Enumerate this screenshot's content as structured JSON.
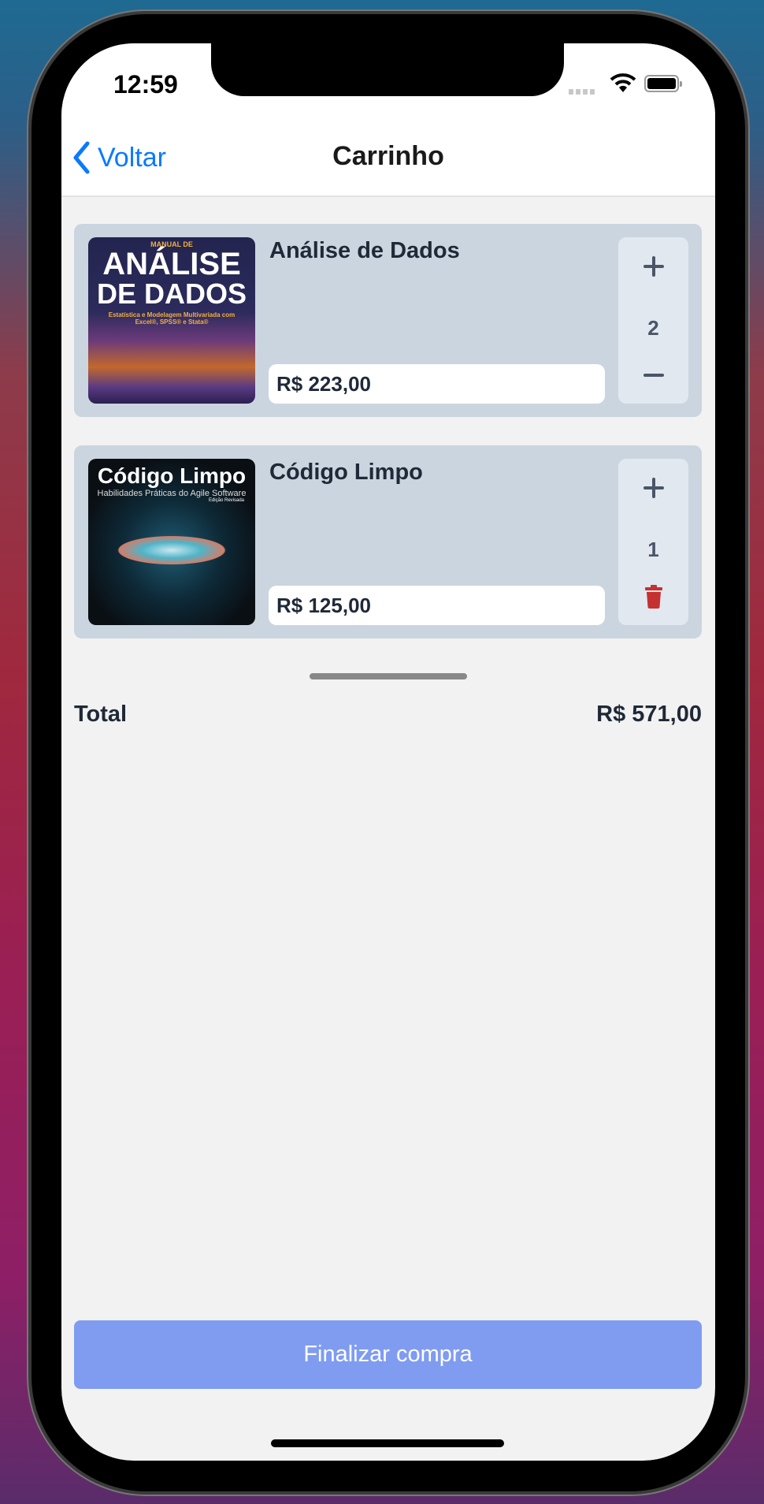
{
  "status_bar": {
    "time": "12:59",
    "icons": [
      "signal-icon",
      "wifi-icon",
      "battery-icon"
    ]
  },
  "nav": {
    "back_label": "Voltar",
    "title": "Carrinho"
  },
  "cart": {
    "items": [
      {
        "title": "Análise de Dados",
        "price": "R$ 223,00",
        "quantity": "2",
        "cover_text": [
          "MANUAL DE",
          "ANÁLISE",
          "DE DADOS",
          "Estatística e Modelagem Multivariada com",
          "Excel®, SPSS® e Stata®"
        ],
        "decrement_icon": "minus-icon"
      },
      {
        "title": "Código Limpo",
        "price": "R$ 125,00",
        "quantity": "1",
        "cover_text": [
          "Código Limpo",
          "Habilidades Práticas do Agile Software",
          "Edição Revisada"
        ],
        "decrement_icon": "trash-icon"
      }
    ]
  },
  "summary": {
    "total_label": "Total",
    "total_value": "R$ 571,00"
  },
  "checkout": {
    "label": "Finalizar compra"
  },
  "colors": {
    "accent": "#0a7aff",
    "card": "#cbd5e0",
    "checkout": "#7f9cf1",
    "trash": "#c53030"
  }
}
